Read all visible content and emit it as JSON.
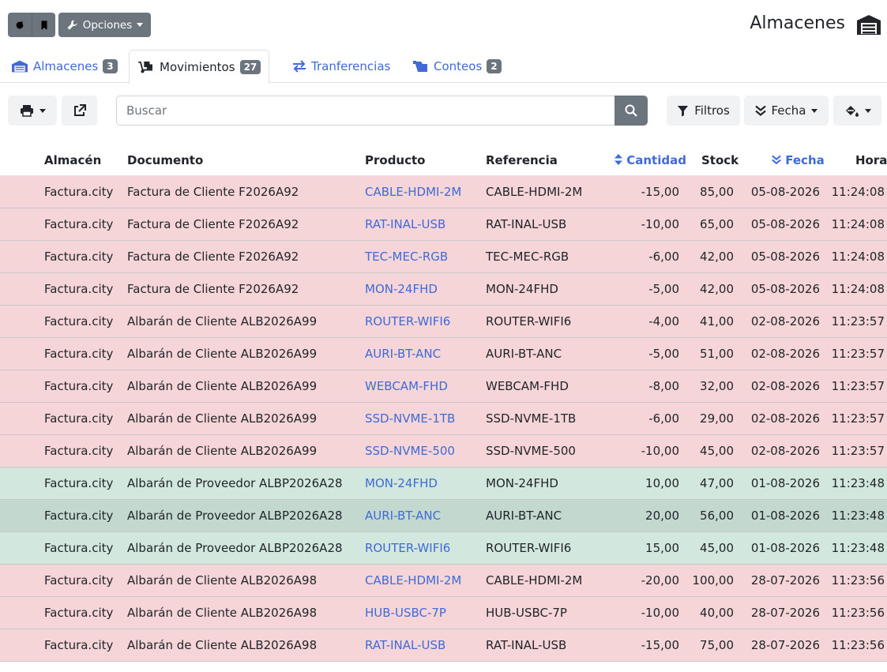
{
  "header": {
    "options_label": "Opciones",
    "title": "Almacenes"
  },
  "tabs": [
    {
      "label": "Almacenes",
      "badge": "3"
    },
    {
      "label": "Movimientos",
      "badge": "27"
    },
    {
      "label": "Tranferencias",
      "badge": ""
    },
    {
      "label": "Conteos",
      "badge": "2"
    }
  ],
  "toolbar": {
    "search_placeholder": "Buscar",
    "filters_label": "Filtros",
    "date_label": "Fecha"
  },
  "table": {
    "columns": [
      "Almacén",
      "Documento",
      "Producto",
      "Referencia",
      "Cantidad",
      "Stock",
      "Fecha",
      "Hora"
    ],
    "rows": [
      {
        "almacen": "Factura.city",
        "documento": "Factura de Cliente F2026A92",
        "producto": "CABLE-HDMI-2M",
        "referencia": "CABLE-HDMI-2M",
        "cantidad": "-15,00",
        "stock": "85,00",
        "fecha": "05-08-2026",
        "hora": "11:24:08",
        "type": "neg"
      },
      {
        "almacen": "Factura.city",
        "documento": "Factura de Cliente F2026A92",
        "producto": "RAT-INAL-USB",
        "referencia": "RAT-INAL-USB",
        "cantidad": "-10,00",
        "stock": "65,00",
        "fecha": "05-08-2026",
        "hora": "11:24:08",
        "type": "neg"
      },
      {
        "almacen": "Factura.city",
        "documento": "Factura de Cliente F2026A92",
        "producto": "TEC-MEC-RGB",
        "referencia": "TEC-MEC-RGB",
        "cantidad": "-6,00",
        "stock": "42,00",
        "fecha": "05-08-2026",
        "hora": "11:24:08",
        "type": "neg"
      },
      {
        "almacen": "Factura.city",
        "documento": "Factura de Cliente F2026A92",
        "producto": "MON-24FHD",
        "referencia": "MON-24FHD",
        "cantidad": "-5,00",
        "stock": "42,00",
        "fecha": "05-08-2026",
        "hora": "11:24:08",
        "type": "neg"
      },
      {
        "almacen": "Factura.city",
        "documento": "Albarán de Cliente ALB2026A99",
        "producto": "ROUTER-WIFI6",
        "referencia": "ROUTER-WIFI6",
        "cantidad": "-4,00",
        "stock": "41,00",
        "fecha": "02-08-2026",
        "hora": "11:23:57",
        "type": "neg"
      },
      {
        "almacen": "Factura.city",
        "documento": "Albarán de Cliente ALB2026A99",
        "producto": "AURI-BT-ANC",
        "referencia": "AURI-BT-ANC",
        "cantidad": "-5,00",
        "stock": "51,00",
        "fecha": "02-08-2026",
        "hora": "11:23:57",
        "type": "neg"
      },
      {
        "almacen": "Factura.city",
        "documento": "Albarán de Cliente ALB2026A99",
        "producto": "WEBCAM-FHD",
        "referencia": "WEBCAM-FHD",
        "cantidad": "-8,00",
        "stock": "32,00",
        "fecha": "02-08-2026",
        "hora": "11:23:57",
        "type": "neg"
      },
      {
        "almacen": "Factura.city",
        "documento": "Albarán de Cliente ALB2026A99",
        "producto": "SSD-NVME-1TB",
        "referencia": "SSD-NVME-1TB",
        "cantidad": "-6,00",
        "stock": "29,00",
        "fecha": "02-08-2026",
        "hora": "11:23:57",
        "type": "neg"
      },
      {
        "almacen": "Factura.city",
        "documento": "Albarán de Cliente ALB2026A99",
        "producto": "SSD-NVME-500",
        "referencia": "SSD-NVME-500",
        "cantidad": "-10,00",
        "stock": "45,00",
        "fecha": "02-08-2026",
        "hora": "11:23:57",
        "type": "neg"
      },
      {
        "almacen": "Factura.city",
        "documento": "Albarán de Proveedor ALBP2026A28",
        "producto": "MON-24FHD",
        "referencia": "MON-24FHD",
        "cantidad": "10,00",
        "stock": "47,00",
        "fecha": "01-08-2026",
        "hora": "11:23:48",
        "type": "pos"
      },
      {
        "almacen": "Factura.city",
        "documento": "Albarán de Proveedor ALBP2026A28",
        "producto": "AURI-BT-ANC",
        "referencia": "AURI-BT-ANC",
        "cantidad": "20,00",
        "stock": "56,00",
        "fecha": "01-08-2026",
        "hora": "11:23:48",
        "type": "sel"
      },
      {
        "almacen": "Factura.city",
        "documento": "Albarán de Proveedor ALBP2026A28",
        "producto": "ROUTER-WIFI6",
        "referencia": "ROUTER-WIFI6",
        "cantidad": "15,00",
        "stock": "45,00",
        "fecha": "01-08-2026",
        "hora": "11:23:48",
        "type": "pos"
      },
      {
        "almacen": "Factura.city",
        "documento": "Albarán de Cliente ALB2026A98",
        "producto": "CABLE-HDMI-2M",
        "referencia": "CABLE-HDMI-2M",
        "cantidad": "-20,00",
        "stock": "100,00",
        "fecha": "28-07-2026",
        "hora": "11:23:56",
        "type": "neg"
      },
      {
        "almacen": "Factura.city",
        "documento": "Albarán de Cliente ALB2026A98",
        "producto": "HUB-USBC-7P",
        "referencia": "HUB-USBC-7P",
        "cantidad": "-10,00",
        "stock": "40,00",
        "fecha": "28-07-2026",
        "hora": "11:23:56",
        "type": "neg"
      },
      {
        "almacen": "Factura.city",
        "documento": "Albarán de Cliente ALB2026A98",
        "producto": "RAT-INAL-USB",
        "referencia": "RAT-INAL-USB",
        "cantidad": "-15,00",
        "stock": "75,00",
        "fecha": "28-07-2026",
        "hora": "11:23:56",
        "type": "neg"
      }
    ]
  },
  "colors": {
    "accent": "#3f6ad8",
    "negative_row": "#f5d5d7",
    "positive_row": "#d2e7dd",
    "selected_row": "#c3d9cf",
    "button_dark": "#6c757d"
  }
}
